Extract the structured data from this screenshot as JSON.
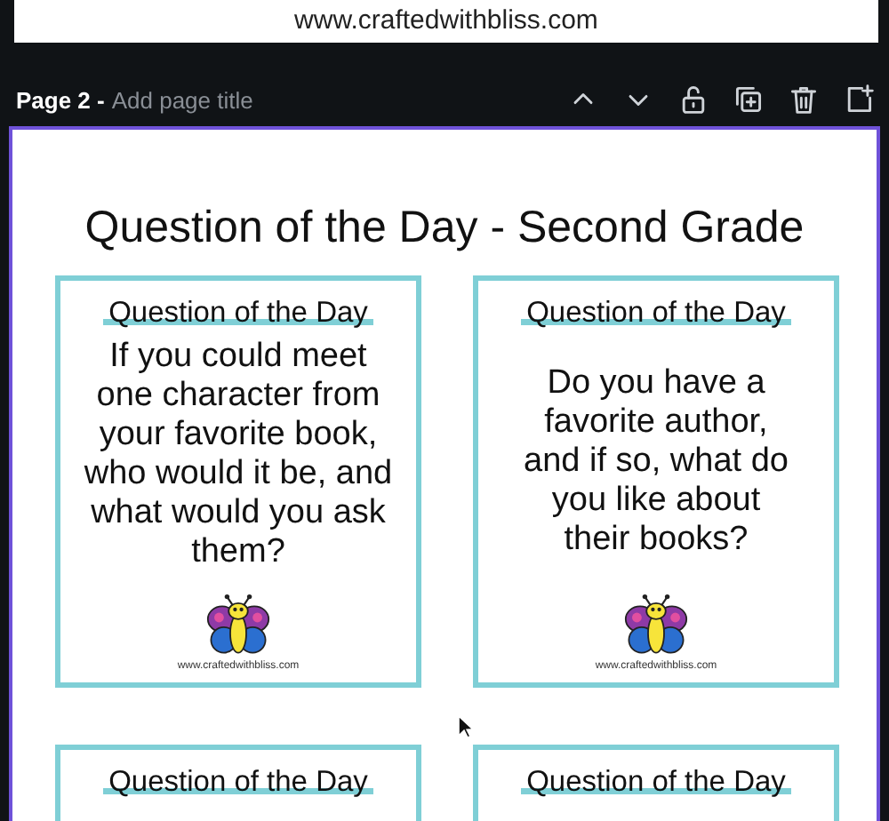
{
  "previous_page": {
    "footer_url": "www.craftedwithbliss.com"
  },
  "page_header": {
    "page_label": "Page 2 -",
    "title_placeholder": "Add page title"
  },
  "page": {
    "title": "Question of the Day - Second Grade",
    "cards": [
      {
        "heading": "Question of the Day",
        "question": "If you could meet\none character from\nyour favorite book,\nwho would it be, and\nwhat would you ask\nthem?",
        "footer_url": "www.craftedwithbliss.com"
      },
      {
        "heading": "Question of the Day",
        "question": "Do you have a\nfavorite author,\nand if so, what do\nyou like about\ntheir books?",
        "footer_url": "www.craftedwithbliss.com"
      },
      {
        "heading": "Question of the Day"
      },
      {
        "heading": "Question of the Day"
      }
    ]
  }
}
